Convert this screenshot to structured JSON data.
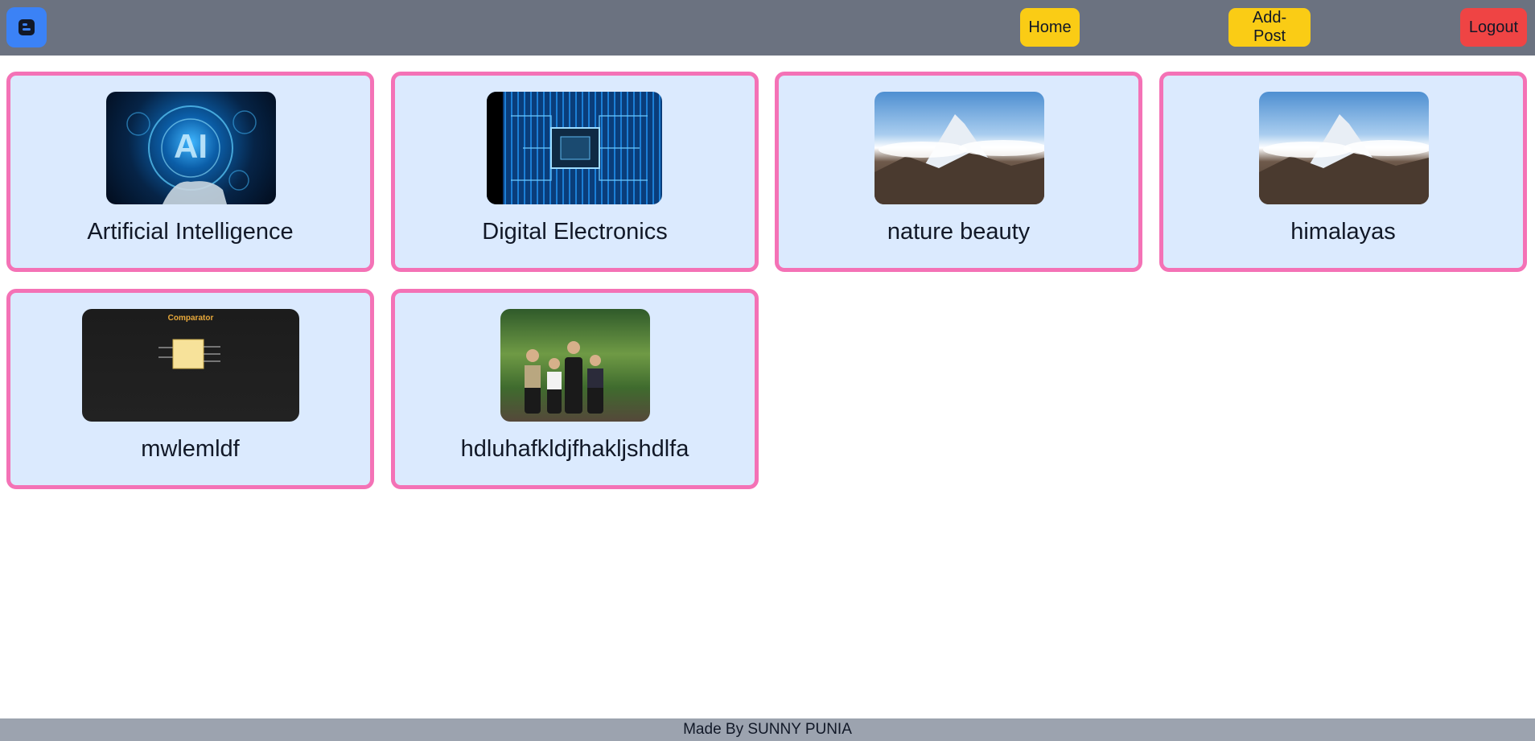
{
  "nav": {
    "logo_icon": "blog-icon",
    "home_label": "Home",
    "add_post_label": "Add-Post",
    "logout_label": "Logout",
    "colors": {
      "bar": "#6b7280",
      "logo": "#3b82f6",
      "home": "#facc15",
      "add_post": "#facc15",
      "logout": "#ef4444"
    }
  },
  "posts": [
    {
      "title": "Artificial Intelligence",
      "image": "ai-hand-image"
    },
    {
      "title": "Digital Electronics",
      "image": "circuit-chip-image"
    },
    {
      "title": "nature beauty",
      "image": "mountain-peak-image"
    },
    {
      "title": "himalayas",
      "image": "mountain-peak-image"
    },
    {
      "title": "mwlemldf",
      "image": "comparator-diagram-image",
      "image_text": "Comparator"
    },
    {
      "title": "hdluhafkldjfhakljshdlfa",
      "image": "group-photo-image"
    }
  ],
  "footer": {
    "text": "Made By SUNNY PUNIA"
  },
  "colors": {
    "card_bg": "#dbeafe",
    "card_border": "#f472b6",
    "footer_bg": "#9ca3af"
  }
}
